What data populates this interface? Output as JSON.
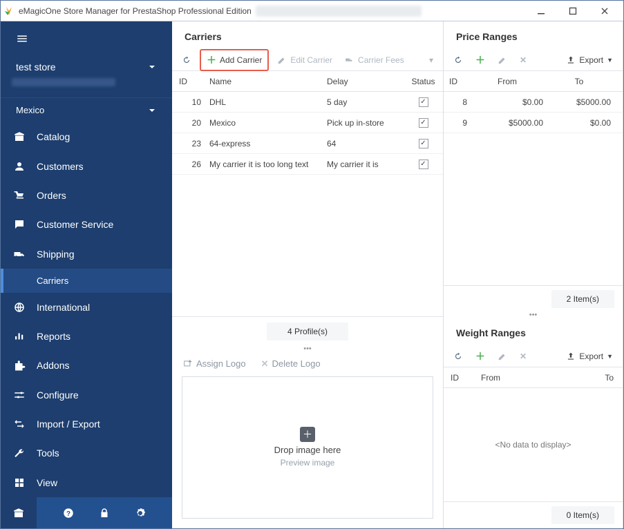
{
  "window": {
    "title": "eMagicOne Store Manager for PrestaShop Professional Edition"
  },
  "sidebar": {
    "store_name": "test store",
    "country": "Mexico",
    "items": [
      {
        "label": "Catalog"
      },
      {
        "label": "Customers"
      },
      {
        "label": "Orders"
      },
      {
        "label": "Customer Service"
      },
      {
        "label": "Shipping",
        "sub": [
          {
            "label": "Carriers"
          }
        ]
      },
      {
        "label": "International"
      },
      {
        "label": "Reports"
      },
      {
        "label": "Addons"
      },
      {
        "label": "Configure"
      },
      {
        "label": "Import / Export"
      },
      {
        "label": "Tools"
      },
      {
        "label": "View"
      }
    ]
  },
  "carriers": {
    "title": "Carriers",
    "add_label": "Add Carrier",
    "edit_label": "Edit Carrier",
    "fees_label": "Carrier Fees",
    "headers": {
      "id": "ID",
      "name": "Name",
      "delay": "Delay",
      "status": "Status"
    },
    "rows": [
      {
        "id": "10",
        "name": "DHL",
        "delay": "5 day",
        "checked": true
      },
      {
        "id": "20",
        "name": "Mexico",
        "delay": "Pick up in-store",
        "checked": true
      },
      {
        "id": "23",
        "name": "64-express",
        "delay": "64",
        "checked": true
      },
      {
        "id": "26",
        "name": "My carrier it is too long text",
        "delay": "My carrier it is",
        "checked": true
      }
    ],
    "footer": "4 Profile(s)",
    "assign_logo": "Assign Logo",
    "delete_logo": "Delete Logo",
    "drop_text": "Drop image here",
    "preview_text": "Preview image"
  },
  "price_ranges": {
    "title": "Price Ranges",
    "export_label": "Export",
    "headers": {
      "id": "ID",
      "from": "From",
      "to": "To"
    },
    "rows": [
      {
        "id": "8",
        "from": "$0.00",
        "to": "$5000.00"
      },
      {
        "id": "9",
        "from": "$5000.00",
        "to": "$0.00"
      }
    ],
    "footer": "2 Item(s)"
  },
  "weight_ranges": {
    "title": "Weight Ranges",
    "export_label": "Export",
    "headers": {
      "id": "ID",
      "from": "From",
      "to": "To"
    },
    "nodata": "<No data to display>",
    "footer": "0 Item(s)"
  }
}
